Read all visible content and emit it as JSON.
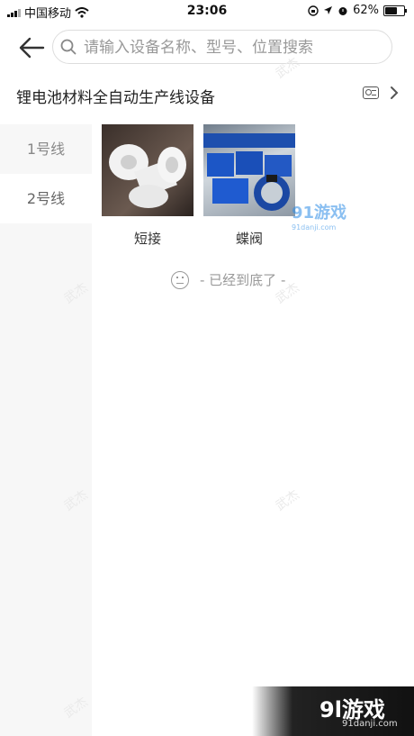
{
  "status_bar": {
    "carrier": "中国移动",
    "time": "23:06",
    "battery": "62%"
  },
  "search": {
    "placeholder": "请输入设备名称、型号、位置搜索"
  },
  "header": {
    "title": "锂电池材料全自动生产线设备"
  },
  "sidebar": {
    "items": [
      {
        "label": "1号线",
        "active": false
      },
      {
        "label": "2号线",
        "active": true
      }
    ]
  },
  "products": [
    {
      "name": "短接"
    },
    {
      "name": "蝶阀"
    }
  ],
  "list_end": {
    "text": "- 已经到底了 -"
  },
  "watermarks": {
    "text": "武杰"
  },
  "branding": {
    "logo_top": "91游戏",
    "logo_top_url": "91danji.com",
    "logo_corner": "9l游戏",
    "logo_corner_url": "91danji.com"
  }
}
